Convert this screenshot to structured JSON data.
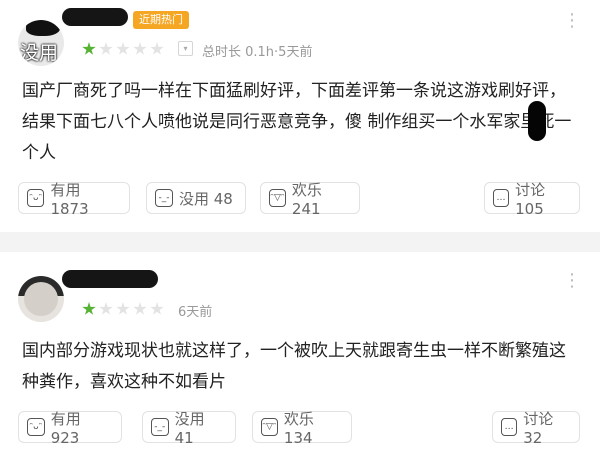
{
  "reviews": [
    {
      "user_overlay": "没用",
      "badge": "近期热门",
      "rating": 1,
      "meta": "总时长 0.1h·5天前",
      "body": "国产厂商死了吗一样在下面猛刷好评，下面差评第一条说这游戏刷好评，结果下面七八个人喷他说是同行恶意竞争，傻  制作组买一个水军家里死一个人",
      "actions": {
        "useful": "有用 1873",
        "useless": "没用 48",
        "fun": "欢乐 241",
        "discuss": "讨论 105"
      }
    },
    {
      "user_overlay": "",
      "badge": "",
      "rating": 1,
      "meta": "6天前",
      "body": "国内部分游戏现状也就这样了，一个被吹上天就跟寄生虫一样不断繁殖这种粪作，喜欢这种不如看片",
      "actions": {
        "useful": "有用 923",
        "useless": "没用 41",
        "fun": "欢乐 134",
        "discuss": "讨论 32"
      }
    }
  ],
  "more_icon": "more-dots-icon",
  "colors": {
    "star_active": "#55b233",
    "badge_bg": "#f5a623",
    "muted_text": "#999999"
  }
}
